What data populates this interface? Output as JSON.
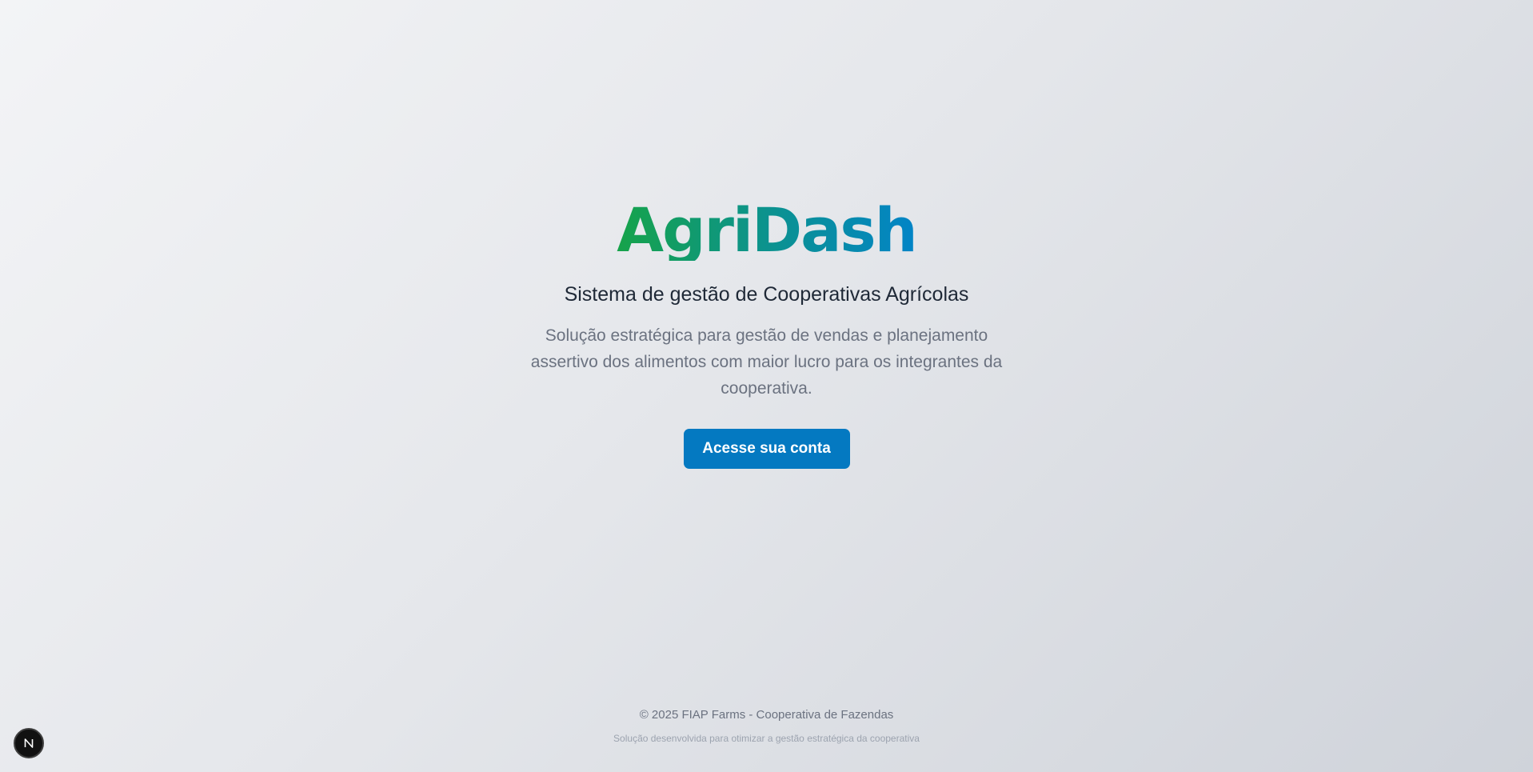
{
  "hero": {
    "brand": "AgriDash",
    "subtitle": "Sistema de gestão de Cooperativas Agrícolas",
    "description": "Solução estratégica para gestão de vendas e planejamento assertivo dos alimentos com maior lucro para os integrantes da cooperativa.",
    "cta_label": "Acesse sua conta"
  },
  "footer": {
    "copyright": "© 2025 FIAP Farms - Cooperativa de Fazendas",
    "tagline": "Solução desenvolvida para otimizar a gestão estratégica da cooperativa"
  },
  "dev_indicator": {
    "icon": "nextjs-icon",
    "letter": "N"
  },
  "colors": {
    "brand_gradient_start": "#16a34a",
    "brand_gradient_mid": "#0d9488",
    "brand_gradient_end": "#0284c7",
    "cta_background": "#0479c1"
  }
}
